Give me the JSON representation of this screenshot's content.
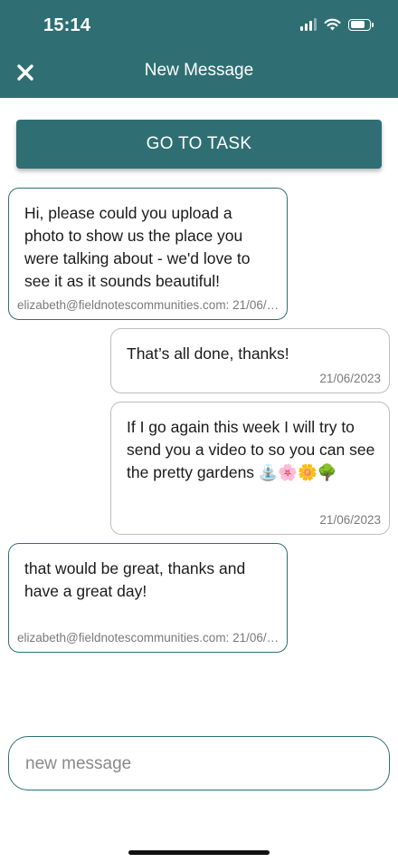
{
  "status_bar": {
    "time": "15:14",
    "battery_level": 0.8
  },
  "header": {
    "title": "New Message",
    "close_icon": "close-icon",
    "background_color": "#2f6f73"
  },
  "goto_button": {
    "label": "GO TO TASK"
  },
  "messages": [
    {
      "direction": "incoming",
      "text": "Hi, please could you upload a photo to show us the place you were talking about - we'd love to see it as it sounds beautiful!",
      "meta": "elizabeth@fieldnotescommunities.com: 21/06/2023"
    },
    {
      "direction": "outgoing",
      "text": "That’s all done, thanks!",
      "meta": "21/06/2023"
    },
    {
      "direction": "outgoing",
      "text": "If I go again this week I will try to send you a video to so you can see the pretty gardens",
      "emoji": "⛲🌸🌼🌳",
      "meta": "21/06/2023"
    },
    {
      "direction": "incoming",
      "text": "that would be great, thanks and have a great day!",
      "meta": "elizabeth@fieldnotescommunities.com: 21/06/2023"
    }
  ],
  "composer": {
    "placeholder": "new message",
    "value": ""
  },
  "colors": {
    "accent": "#2f6f73",
    "outgoing_border": "#bdbdbd"
  }
}
